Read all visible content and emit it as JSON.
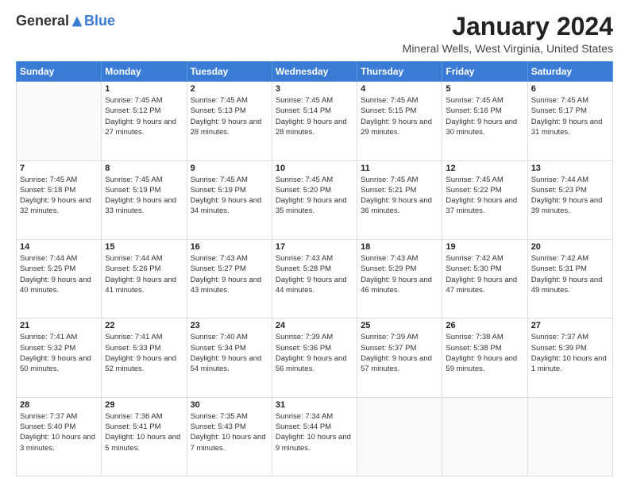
{
  "logo": {
    "general": "General",
    "blue": "Blue"
  },
  "title": "January 2024",
  "subtitle": "Mineral Wells, West Virginia, United States",
  "headers": [
    "Sunday",
    "Monday",
    "Tuesday",
    "Wednesday",
    "Thursday",
    "Friday",
    "Saturday"
  ],
  "weeks": [
    [
      {
        "day": "",
        "sunrise": "",
        "sunset": "",
        "daylight": ""
      },
      {
        "day": "1",
        "sunrise": "Sunrise: 7:45 AM",
        "sunset": "Sunset: 5:12 PM",
        "daylight": "Daylight: 9 hours and 27 minutes."
      },
      {
        "day": "2",
        "sunrise": "Sunrise: 7:45 AM",
        "sunset": "Sunset: 5:13 PM",
        "daylight": "Daylight: 9 hours and 28 minutes."
      },
      {
        "day": "3",
        "sunrise": "Sunrise: 7:45 AM",
        "sunset": "Sunset: 5:14 PM",
        "daylight": "Daylight: 9 hours and 28 minutes."
      },
      {
        "day": "4",
        "sunrise": "Sunrise: 7:45 AM",
        "sunset": "Sunset: 5:15 PM",
        "daylight": "Daylight: 9 hours and 29 minutes."
      },
      {
        "day": "5",
        "sunrise": "Sunrise: 7:45 AM",
        "sunset": "Sunset: 5:16 PM",
        "daylight": "Daylight: 9 hours and 30 minutes."
      },
      {
        "day": "6",
        "sunrise": "Sunrise: 7:45 AM",
        "sunset": "Sunset: 5:17 PM",
        "daylight": "Daylight: 9 hours and 31 minutes."
      }
    ],
    [
      {
        "day": "7",
        "sunrise": "Sunrise: 7:45 AM",
        "sunset": "Sunset: 5:18 PM",
        "daylight": "Daylight: 9 hours and 32 minutes."
      },
      {
        "day": "8",
        "sunrise": "Sunrise: 7:45 AM",
        "sunset": "Sunset: 5:19 PM",
        "daylight": "Daylight: 9 hours and 33 minutes."
      },
      {
        "day": "9",
        "sunrise": "Sunrise: 7:45 AM",
        "sunset": "Sunset: 5:19 PM",
        "daylight": "Daylight: 9 hours and 34 minutes."
      },
      {
        "day": "10",
        "sunrise": "Sunrise: 7:45 AM",
        "sunset": "Sunset: 5:20 PM",
        "daylight": "Daylight: 9 hours and 35 minutes."
      },
      {
        "day": "11",
        "sunrise": "Sunrise: 7:45 AM",
        "sunset": "Sunset: 5:21 PM",
        "daylight": "Daylight: 9 hours and 36 minutes."
      },
      {
        "day": "12",
        "sunrise": "Sunrise: 7:45 AM",
        "sunset": "Sunset: 5:22 PM",
        "daylight": "Daylight: 9 hours and 37 minutes."
      },
      {
        "day": "13",
        "sunrise": "Sunrise: 7:44 AM",
        "sunset": "Sunset: 5:23 PM",
        "daylight": "Daylight: 9 hours and 39 minutes."
      }
    ],
    [
      {
        "day": "14",
        "sunrise": "Sunrise: 7:44 AM",
        "sunset": "Sunset: 5:25 PM",
        "daylight": "Daylight: 9 hours and 40 minutes."
      },
      {
        "day": "15",
        "sunrise": "Sunrise: 7:44 AM",
        "sunset": "Sunset: 5:26 PM",
        "daylight": "Daylight: 9 hours and 41 minutes."
      },
      {
        "day": "16",
        "sunrise": "Sunrise: 7:43 AM",
        "sunset": "Sunset: 5:27 PM",
        "daylight": "Daylight: 9 hours and 43 minutes."
      },
      {
        "day": "17",
        "sunrise": "Sunrise: 7:43 AM",
        "sunset": "Sunset: 5:28 PM",
        "daylight": "Daylight: 9 hours and 44 minutes."
      },
      {
        "day": "18",
        "sunrise": "Sunrise: 7:43 AM",
        "sunset": "Sunset: 5:29 PM",
        "daylight": "Daylight: 9 hours and 46 minutes."
      },
      {
        "day": "19",
        "sunrise": "Sunrise: 7:42 AM",
        "sunset": "Sunset: 5:30 PM",
        "daylight": "Daylight: 9 hours and 47 minutes."
      },
      {
        "day": "20",
        "sunrise": "Sunrise: 7:42 AM",
        "sunset": "Sunset: 5:31 PM",
        "daylight": "Daylight: 9 hours and 49 minutes."
      }
    ],
    [
      {
        "day": "21",
        "sunrise": "Sunrise: 7:41 AM",
        "sunset": "Sunset: 5:32 PM",
        "daylight": "Daylight: 9 hours and 50 minutes."
      },
      {
        "day": "22",
        "sunrise": "Sunrise: 7:41 AM",
        "sunset": "Sunset: 5:33 PM",
        "daylight": "Daylight: 9 hours and 52 minutes."
      },
      {
        "day": "23",
        "sunrise": "Sunrise: 7:40 AM",
        "sunset": "Sunset: 5:34 PM",
        "daylight": "Daylight: 9 hours and 54 minutes."
      },
      {
        "day": "24",
        "sunrise": "Sunrise: 7:39 AM",
        "sunset": "Sunset: 5:36 PM",
        "daylight": "Daylight: 9 hours and 56 minutes."
      },
      {
        "day": "25",
        "sunrise": "Sunrise: 7:39 AM",
        "sunset": "Sunset: 5:37 PM",
        "daylight": "Daylight: 9 hours and 57 minutes."
      },
      {
        "day": "26",
        "sunrise": "Sunrise: 7:38 AM",
        "sunset": "Sunset: 5:38 PM",
        "daylight": "Daylight: 9 hours and 59 minutes."
      },
      {
        "day": "27",
        "sunrise": "Sunrise: 7:37 AM",
        "sunset": "Sunset: 5:39 PM",
        "daylight": "Daylight: 10 hours and 1 minute."
      }
    ],
    [
      {
        "day": "28",
        "sunrise": "Sunrise: 7:37 AM",
        "sunset": "Sunset: 5:40 PM",
        "daylight": "Daylight: 10 hours and 3 minutes."
      },
      {
        "day": "29",
        "sunrise": "Sunrise: 7:36 AM",
        "sunset": "Sunset: 5:41 PM",
        "daylight": "Daylight: 10 hours and 5 minutes."
      },
      {
        "day": "30",
        "sunrise": "Sunrise: 7:35 AM",
        "sunset": "Sunset: 5:43 PM",
        "daylight": "Daylight: 10 hours and 7 minutes."
      },
      {
        "day": "31",
        "sunrise": "Sunrise: 7:34 AM",
        "sunset": "Sunset: 5:44 PM",
        "daylight": "Daylight: 10 hours and 9 minutes."
      },
      {
        "day": "",
        "sunrise": "",
        "sunset": "",
        "daylight": ""
      },
      {
        "day": "",
        "sunrise": "",
        "sunset": "",
        "daylight": ""
      },
      {
        "day": "",
        "sunrise": "",
        "sunset": "",
        "daylight": ""
      }
    ]
  ]
}
